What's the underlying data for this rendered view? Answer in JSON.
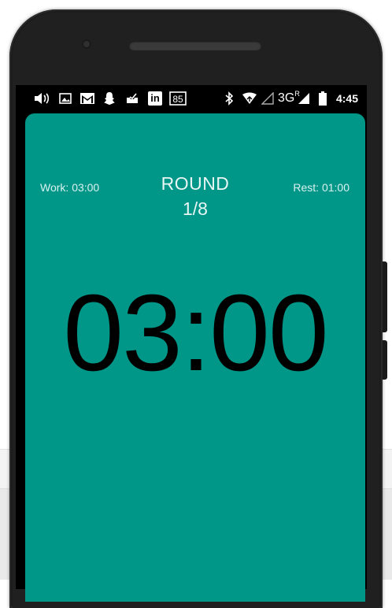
{
  "status_bar": {
    "time": "4:45",
    "network": "3G",
    "network_sup": "R",
    "left_icons": [
      "volume-icon",
      "image-icon",
      "gmail-icon",
      "snapchat-icon",
      "inbox-icon",
      "linkedin-icon",
      "calendar-icon"
    ],
    "calendar_day": "85",
    "linkedin_text": "in"
  },
  "timer_screen": {
    "work_label": "Work: 03:00",
    "rest_label": "Rest: 01:00",
    "round_title": "ROUND",
    "round_count": "1/8",
    "time_display": "03:00",
    "background_color": "#009688"
  }
}
